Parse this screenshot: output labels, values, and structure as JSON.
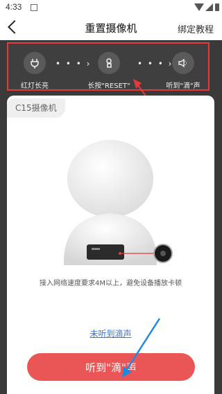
{
  "status_bar": {
    "time": "4:33"
  },
  "header": {
    "title": "重置摄像机",
    "tutorial_link": "绑定教程"
  },
  "steps": [
    {
      "label": "红灯长亮",
      "icon": "plug-icon"
    },
    {
      "label": "长按\"RESET\"",
      "icon": "hand-press-icon"
    },
    {
      "label": "听到\"滴\"声",
      "icon": "speaker-icon"
    }
  ],
  "card": {
    "model": "C15摄像机",
    "hint": "接入网络速度要求4M以上，避免设备播放卡顿",
    "not_heard_link": "未听到滴声",
    "confirm_button": "听到\"滴\"声"
  },
  "colors": {
    "accent": "#ea5656",
    "highlight": "#e8393a",
    "link": "#2f74e8",
    "arrow_blue": "#1e88e5"
  }
}
